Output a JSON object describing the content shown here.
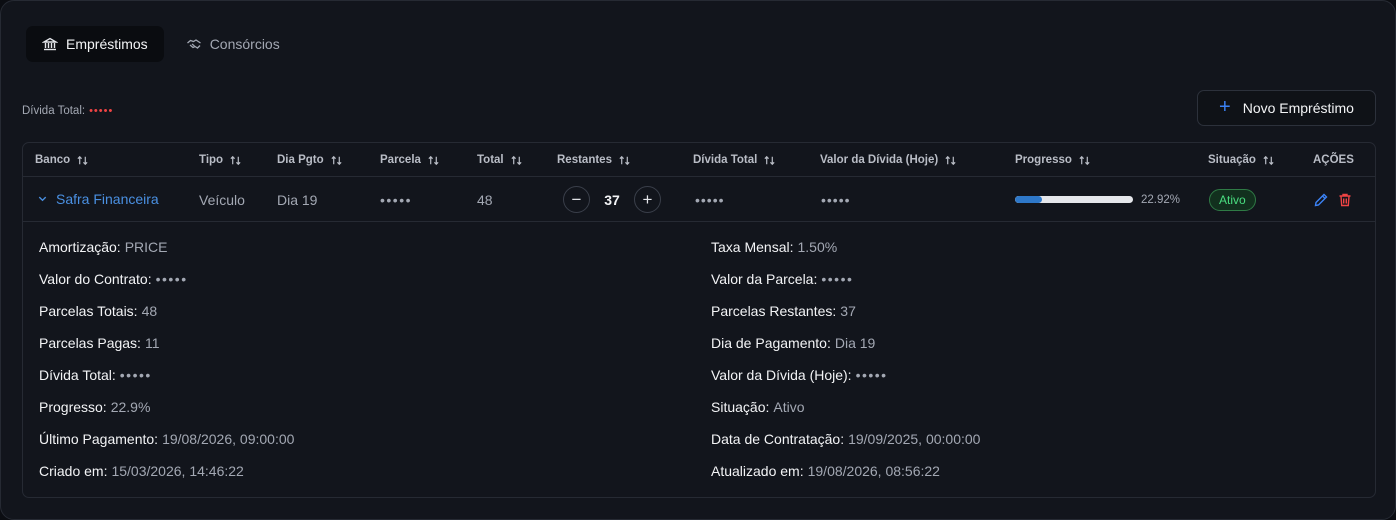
{
  "tabs": [
    {
      "label": "Empréstimos",
      "icon": "bank-icon",
      "active": true
    },
    {
      "label": "Consórcios",
      "icon": "handshake-icon",
      "active": false
    }
  ],
  "summary": {
    "label": "Dívida Total:",
    "value": "•••••"
  },
  "new_button": {
    "label": "Novo Empréstimo",
    "icon": "plus-icon"
  },
  "columns": [
    "Banco",
    "Tipo",
    "Dia Pgto",
    "Parcela",
    "Total",
    "Restantes",
    "Dívida Total",
    "Valor da Dívida (Hoje)",
    "Progresso",
    "Situação",
    "AÇÕES"
  ],
  "row": {
    "bank": "Safra Financeira",
    "type": "Veículo",
    "due_day": "Dia 19",
    "installment": "•••••",
    "total": "48",
    "remaining": "37",
    "debt_total": "•••••",
    "debt_today": "•••••",
    "progress_label": "22.92%",
    "progress_fraction": 0.2292,
    "status": "Ativo"
  },
  "details": {
    "left": [
      {
        "key": "Amortização:",
        "value": "PRICE"
      },
      {
        "key": "Valor do Contrato:",
        "value": "•••••"
      },
      {
        "key": "Parcelas Totais:",
        "value": "48"
      },
      {
        "key": "Parcelas Pagas:",
        "value": "11"
      },
      {
        "key": "Dívida Total:",
        "value": "•••••"
      },
      {
        "key": "Progresso:",
        "value": "22.9%"
      },
      {
        "key": "Último Pagamento:",
        "value": "19/08/2026, 09:00:00"
      },
      {
        "key": "Criado em:",
        "value": "15/03/2026, 14:46:22"
      }
    ],
    "right": [
      {
        "key": "Taxa Mensal:",
        "value": "1.50%"
      },
      {
        "key": "Valor da Parcela:",
        "value": "•••••"
      },
      {
        "key": "Parcelas Restantes:",
        "value": "37"
      },
      {
        "key": "Dia de Pagamento:",
        "value": "Dia 19"
      },
      {
        "key": "Valor da Dívida (Hoje):",
        "value": "•••••"
      },
      {
        "key": "Situação:",
        "value": "Ativo"
      },
      {
        "key": "Data de Contratação:",
        "value": "19/09/2025, 00:00:00"
      },
      {
        "key": "Atualizado em:",
        "value": "19/08/2026, 08:56:22"
      }
    ]
  },
  "colors": {
    "accent": "#3b82f6",
    "danger": "#ef4444",
    "success": "#4ade80"
  }
}
